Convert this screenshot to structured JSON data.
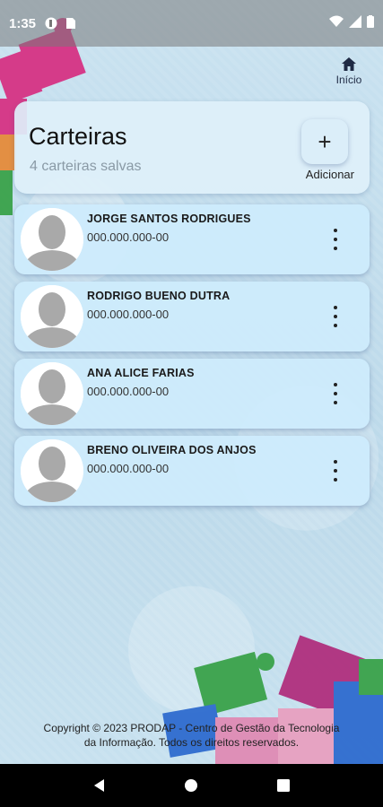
{
  "status_bar": {
    "time": "1:35"
  },
  "top_nav": {
    "home_label": "Início"
  },
  "header": {
    "title": "Carteiras",
    "subtitle": "4 carteiras salvas",
    "add_label": "Adicionar",
    "add_symbol": "+"
  },
  "wallets": [
    {
      "name": "JORGE SANTOS RODRIGUES",
      "document": "000.000.000-00"
    },
    {
      "name": "RODRIGO BUENO DUTRA",
      "document": "000.000.000-00"
    },
    {
      "name": "ANA ALICE FARIAS",
      "document": "000.000.000-00"
    },
    {
      "name": "BRENO OLIVEIRA DOS ANJOS",
      "document": "000.000.000-00"
    }
  ],
  "footer": {
    "line1": "Copyright © 2023  PRODAP - Centro de Gestão da Tecnologia",
    "line2": "da Informação. Todos os direitos reservados."
  },
  "colors": {
    "accent": "#1f2a44",
    "card": "#cdebfc",
    "puzzle_pink": "#d63384",
    "puzzle_green": "#3aa24a",
    "puzzle_blue": "#2f6ccf",
    "puzzle_purple": "#8e2b9c"
  },
  "icons": [
    "wifi-icon",
    "signal-icon",
    "battery-icon",
    "home-icon",
    "plus-icon",
    "more-vert-icon",
    "back-icon",
    "home-nav-icon",
    "recents-icon"
  ]
}
